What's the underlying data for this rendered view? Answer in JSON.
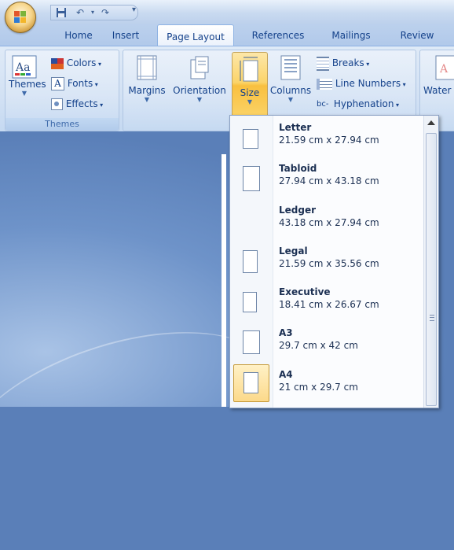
{
  "tabs": [
    "Home",
    "Insert",
    "Page Layout",
    "References",
    "Mailings",
    "Review"
  ],
  "ribbon": {
    "themes": {
      "themes_label": "Themes",
      "colors_label": "Colors",
      "fonts_label": "Fonts",
      "effects_label": "Effects",
      "group_label": "Themes"
    },
    "page_setup": {
      "margins_label": "Margins",
      "orientation_label": "Orientation",
      "size_label": "Size",
      "columns_label": "Columns",
      "breaks_label": "Breaks",
      "line_numbers_label": "Line Numbers",
      "hyphenation_label": "Hyphenation"
    },
    "watermark_label": "Water"
  },
  "size_menu": {
    "items": [
      {
        "name": "Letter",
        "dimensions": "21.59 cm x 27.94 cm"
      },
      {
        "name": "Tabloid",
        "dimensions": "27.94 cm x 43.18 cm"
      },
      {
        "name": "Ledger",
        "dimensions": "43.18 cm x 27.94 cm"
      },
      {
        "name": "Legal",
        "dimensions": "21.59 cm x 35.56 cm"
      },
      {
        "name": "Executive",
        "dimensions": "18.41 cm x 26.67 cm"
      },
      {
        "name": "A3",
        "dimensions": "29.7 cm x 42 cm"
      },
      {
        "name": "A4",
        "dimensions": "21 cm x 29.7 cm"
      }
    ],
    "selected": "A4"
  },
  "colors": {
    "ribbon_text": "#15428b",
    "selection": "#fbd46a"
  }
}
